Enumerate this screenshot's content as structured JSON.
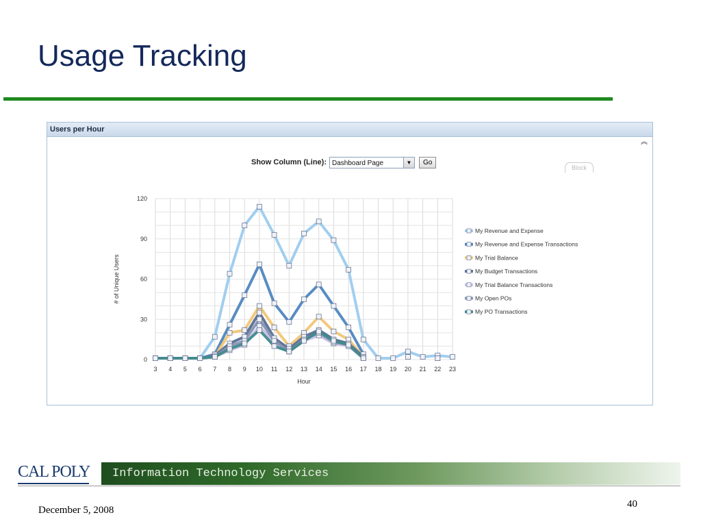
{
  "slide": {
    "title": "Usage Tracking"
  },
  "panel": {
    "header": "Users per Hour",
    "collapse_icon": "double-chevron-up-icon",
    "show_column_label": "Show Column (Line):",
    "select_value": "Dashboard Page",
    "go_label": "Go",
    "block_label": "Block"
  },
  "footer": {
    "logo": "CAL POLY",
    "band_text": "Information Technology Services",
    "date": "December 5, 2008",
    "page_number": "40"
  },
  "chart_data": {
    "type": "line",
    "title": "",
    "xlabel": "Hour",
    "ylabel": "# of Unique Users",
    "ylim": [
      0,
      120
    ],
    "yticks": [
      0,
      30,
      60,
      90,
      120
    ],
    "x": [
      3,
      4,
      5,
      6,
      7,
      8,
      9,
      10,
      11,
      12,
      13,
      14,
      15,
      16,
      17,
      18,
      19,
      20,
      21,
      22,
      23
    ],
    "grid": true,
    "legend_position": "right",
    "series": [
      {
        "name": "My Revenue and Expense",
        "color": "#9ccbee",
        "values": [
          1,
          1,
          1,
          1,
          17,
          64,
          100,
          114,
          93,
          70,
          94,
          103,
          89,
          67,
          15,
          1,
          1,
          6,
          2,
          3,
          2
        ]
      },
      {
        "name": "My Revenue and Expense Transactions",
        "color": "#4f86c0",
        "values": [
          1,
          1,
          1,
          1,
          4,
          26,
          48,
          71,
          42,
          28,
          45,
          56,
          40,
          24,
          4,
          null,
          null,
          null,
          null,
          null,
          null
        ]
      },
      {
        "name": "My Trial Balance",
        "color": "#f1c675",
        "values": [
          1,
          1,
          1,
          1,
          2,
          20,
          22,
          40,
          24,
          10,
          20,
          32,
          21,
          15,
          2,
          null,
          null,
          null,
          null,
          null,
          null
        ]
      },
      {
        "name": "My Budget Transactions",
        "color": "#5a6f92",
        "values": [
          1,
          1,
          1,
          1,
          3,
          12,
          17,
          35,
          16,
          8,
          17,
          22,
          15,
          12,
          2,
          null,
          null,
          null,
          null,
          null,
          null
        ]
      },
      {
        "name": "My Trial Balance Transactions",
        "color": "#c9bfe3",
        "values": [
          1,
          1,
          1,
          1,
          2,
          7,
          11,
          25,
          12,
          6,
          14,
          18,
          12,
          10,
          1,
          null,
          null,
          null,
          null,
          null,
          null
        ]
      },
      {
        "name": "My Open POs",
        "color": "#8594b4",
        "values": [
          1,
          1,
          1,
          1,
          2,
          10,
          14,
          30,
          14,
          6,
          15,
          20,
          13,
          11,
          1,
          null,
          null,
          2,
          null,
          1,
          null
        ]
      },
      {
        "name": "My PO Transactions",
        "color": "#3f8a8c",
        "values": [
          1,
          1,
          1,
          1,
          2,
          8,
          12,
          22,
          10,
          6,
          14,
          21,
          14,
          11,
          1,
          null,
          null,
          2,
          null,
          1,
          null
        ]
      }
    ]
  }
}
